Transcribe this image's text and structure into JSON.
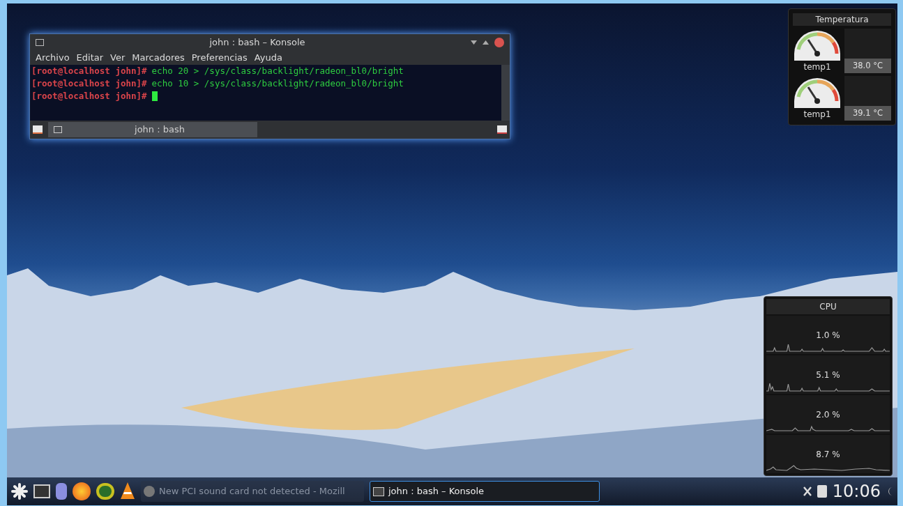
{
  "konsole": {
    "title": "john : bash – Konsole",
    "menu": [
      "Archivo",
      "Editar",
      "Ver",
      "Marcadores",
      "Preferencias",
      "Ayuda"
    ],
    "lines": [
      {
        "prompt": "[root@localhost john]#",
        "command": "echo 20 > /sys/class/backlight/radeon_bl0/bright"
      },
      {
        "prompt": "[root@localhost john]#",
        "command": "echo 10 > /sys/class/backlight/radeon_bl0/bright"
      },
      {
        "prompt": "[root@localhost john]#"
      }
    ],
    "tab": "john : bash"
  },
  "temperature": {
    "title": "Temperatura",
    "sensors": [
      {
        "name": "temp1",
        "reading": "38.0 °C"
      },
      {
        "name": "temp1",
        "reading": "39.1 °C"
      }
    ]
  },
  "cpu": {
    "title": "CPU",
    "cores": [
      {
        "reading": "1.0 %"
      },
      {
        "reading": "5.1 %"
      },
      {
        "reading": "2.0 %"
      },
      {
        "reading": "8.7 %"
      }
    ]
  },
  "taskbar": {
    "tasks": [
      {
        "label": "New PCI sound card not detected - Mozill",
        "selected": false
      },
      {
        "label": "john : bash – Konsole",
        "selected": true
      }
    ],
    "clock": "10:06"
  }
}
